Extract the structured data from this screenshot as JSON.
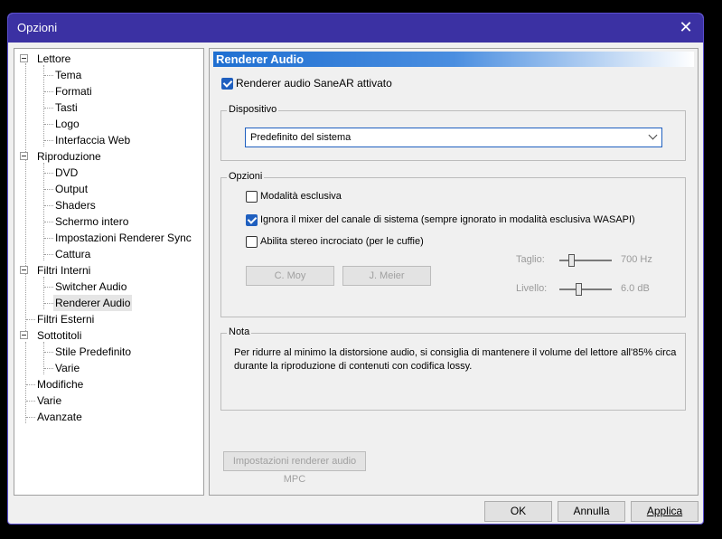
{
  "window": {
    "title": "Opzioni",
    "close_label": "✕"
  },
  "tree": {
    "items": [
      {
        "label": "Lettore",
        "level": 0,
        "expandable": true
      },
      {
        "label": "Tema",
        "level": 1
      },
      {
        "label": "Formati",
        "level": 1
      },
      {
        "label": "Tasti",
        "level": 1
      },
      {
        "label": "Logo",
        "level": 1
      },
      {
        "label": "Interfaccia Web",
        "level": 1
      },
      {
        "label": "Riproduzione",
        "level": 0,
        "expandable": true
      },
      {
        "label": "DVD",
        "level": 1
      },
      {
        "label": "Output",
        "level": 1
      },
      {
        "label": "Shaders",
        "level": 1
      },
      {
        "label": "Schermo intero",
        "level": 1
      },
      {
        "label": "Impostazioni Renderer Sync",
        "level": 1
      },
      {
        "label": "Cattura",
        "level": 1
      },
      {
        "label": "Filtri Interni",
        "level": 0,
        "expandable": true
      },
      {
        "label": "Switcher Audio",
        "level": 1
      },
      {
        "label": "Renderer Audio",
        "level": 1,
        "selected": true
      },
      {
        "label": "Filtri Esterni",
        "level": 0
      },
      {
        "label": "Sottotitoli",
        "level": 0,
        "expandable": true
      },
      {
        "label": "Stile Predefinito",
        "level": 1
      },
      {
        "label": "Varie",
        "level": 1
      },
      {
        "label": "Modifiche",
        "level": 0
      },
      {
        "label": "Varie",
        "level": 0
      },
      {
        "label": "Avanzate",
        "level": 0
      }
    ]
  },
  "panel": {
    "title": "Renderer Audio",
    "enable_label": "Renderer audio SaneAR attivato",
    "enable_checked": true,
    "device_group": "Dispositivo",
    "device_value": "Predefinito del sistema",
    "options_group": "Opzioni",
    "exclusive_label": "Modalità esclusiva",
    "exclusive_checked": false,
    "ignore_mixer_label": "Ignora il mixer del canale di sistema (sempre ignorato in modalità esclusiva WASAPI)",
    "ignore_mixer_checked": true,
    "crossfeed_label": "Abilita stereo incrociato (per le cuffie)",
    "crossfeed_checked": false,
    "cmoy_label": "C. Moy",
    "jmeier_label": "J. Meier",
    "cut_label": "Taglio:",
    "cut_value": "700 Hz",
    "cut_level": 0.2,
    "level_label": "Livello:",
    "level_value": "6.0 dB",
    "level_level": 0.35,
    "note_group": "Nota",
    "note_line1": "Per ridurre al minimo la distorsione audio, si consiglia di mantenere il volume del lettore all'85% circa",
    "note_line2": "durante la riproduzione di contenuti con codifica lossy.",
    "mpc_settings_label": "Impostazioni renderer audio MPC"
  },
  "footer": {
    "ok_label": "OK",
    "cancel_label": "Annulla",
    "apply_label": "Applica"
  },
  "colors": {
    "titlebar": "#3b31a3",
    "accent": "#1f5fbf",
    "header_gradient_start": "#1f6fd1"
  }
}
